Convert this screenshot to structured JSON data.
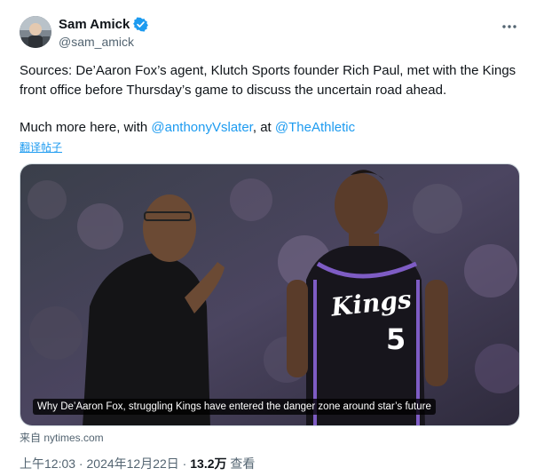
{
  "author": {
    "display_name": "Sam Amick",
    "handle": "@sam_amick",
    "verified": true,
    "avatar_icon": "avatar-photo",
    "verified_color": "#1d9bf0"
  },
  "menu": {
    "icon": "more-horizontal-icon"
  },
  "tweet": {
    "paragraph1": "Sources: De’Aaron Fox’s agent, Klutch Sports founder Rich Paul, met with the Kings front office before Thursday’s game to discuss the uncertain road ahead.",
    "paragraph2_prefix": "Much more here, with ",
    "mention1": "@anthonyVslater",
    "paragraph2_middle": ", at ",
    "mention2": "@TheAthletic",
    "translate_label": "翻译帖子"
  },
  "link_card": {
    "caption": "Why De’Aaron Fox, struggling Kings have entered the danger zone around star’s future",
    "source": "来自 nytimes.com",
    "jersey_wordmark": "Kings",
    "jersey_number": "5"
  },
  "meta": {
    "time": "上午12:03",
    "separator1": " · ",
    "date": "2024年12月22日",
    "separator2": " · ",
    "views_count": "13.2万",
    "views_label": " 查看"
  },
  "colors": {
    "link": "#1d9bf0",
    "text": "#0f1419",
    "secondary_text": "#536471",
    "border": "#cfd9de"
  }
}
